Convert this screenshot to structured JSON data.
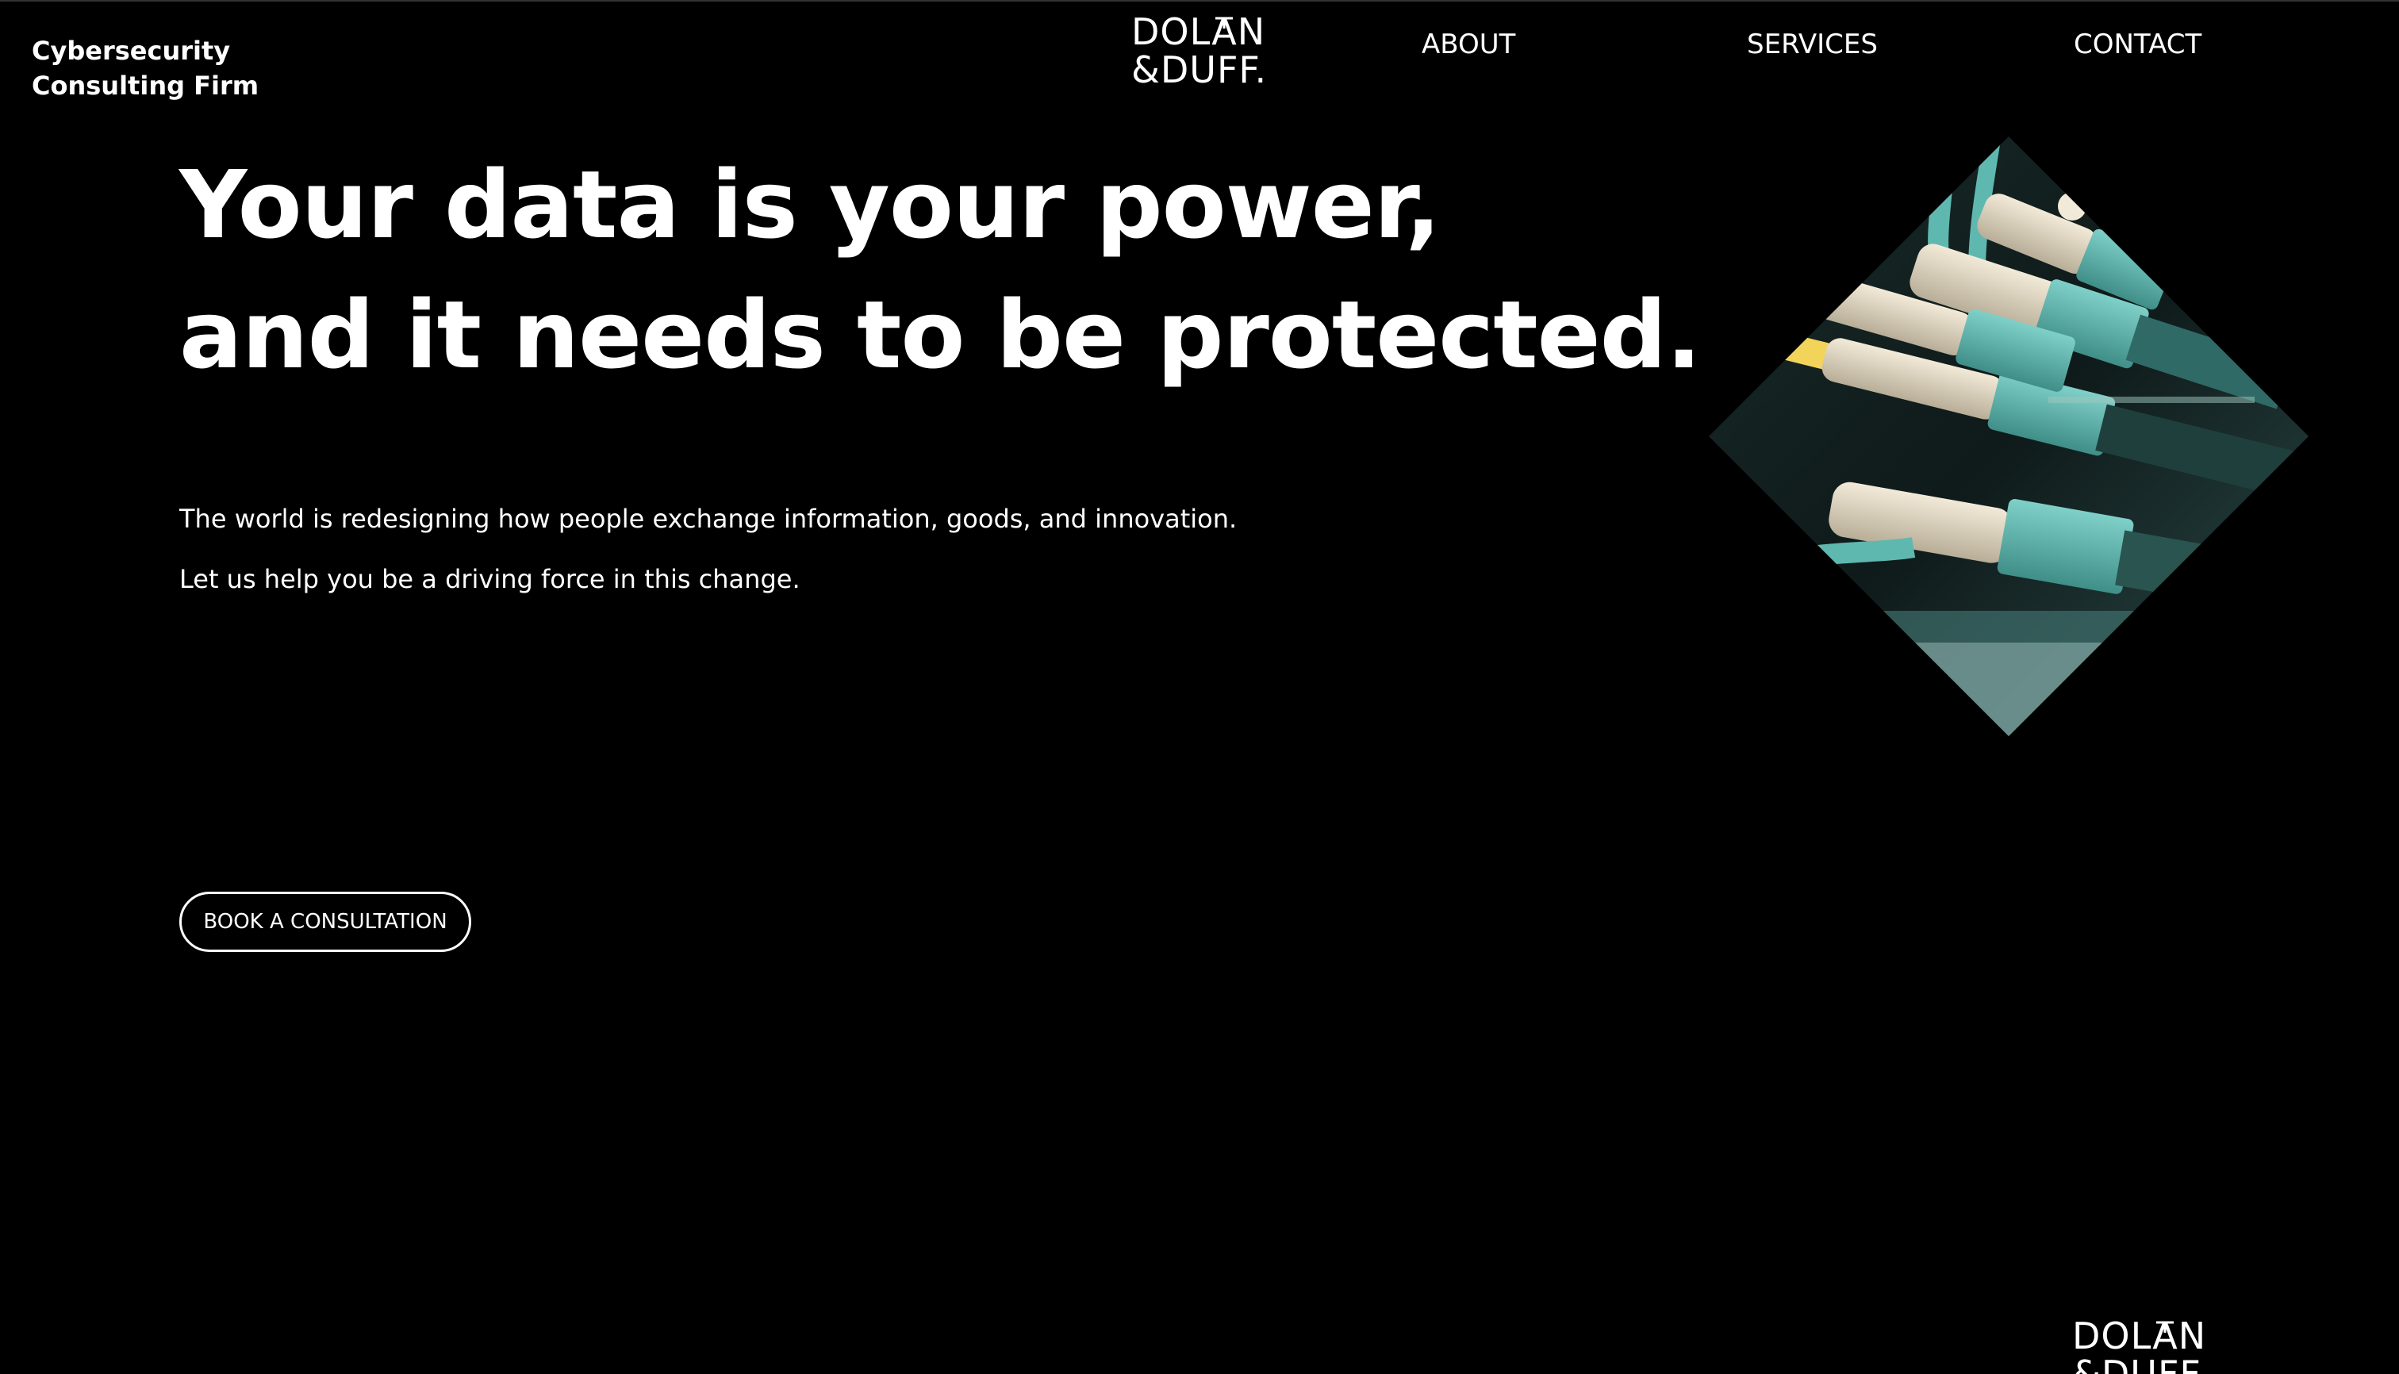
{
  "header": {
    "tagline_line1": "Cybersecurity",
    "tagline_line2": "Consulting Firm",
    "logo_line1": "DOLAN",
    "logo_line2": "&DUFF.",
    "nav": {
      "about": "ABOUT",
      "services": "SERVICES",
      "contact": "CONTACT"
    }
  },
  "hero": {
    "headline_line1": "Your data is your power,",
    "headline_line2": "and it needs to be protected.",
    "paragraph1": "The world is redesigning how people exchange information, goods, and innovation.",
    "paragraph2": "Let us help you be a driving force in this change.",
    "cta_label": "BOOK A CONSULTATION",
    "image_icon": "fiber-optic-cables-photo"
  },
  "footer": {
    "logo_line1": "DOLAN",
    "logo_line2": "&DUFF."
  },
  "colors": {
    "background": "#000000",
    "text": "#ffffff",
    "image_accent": "#5fb8b0"
  }
}
